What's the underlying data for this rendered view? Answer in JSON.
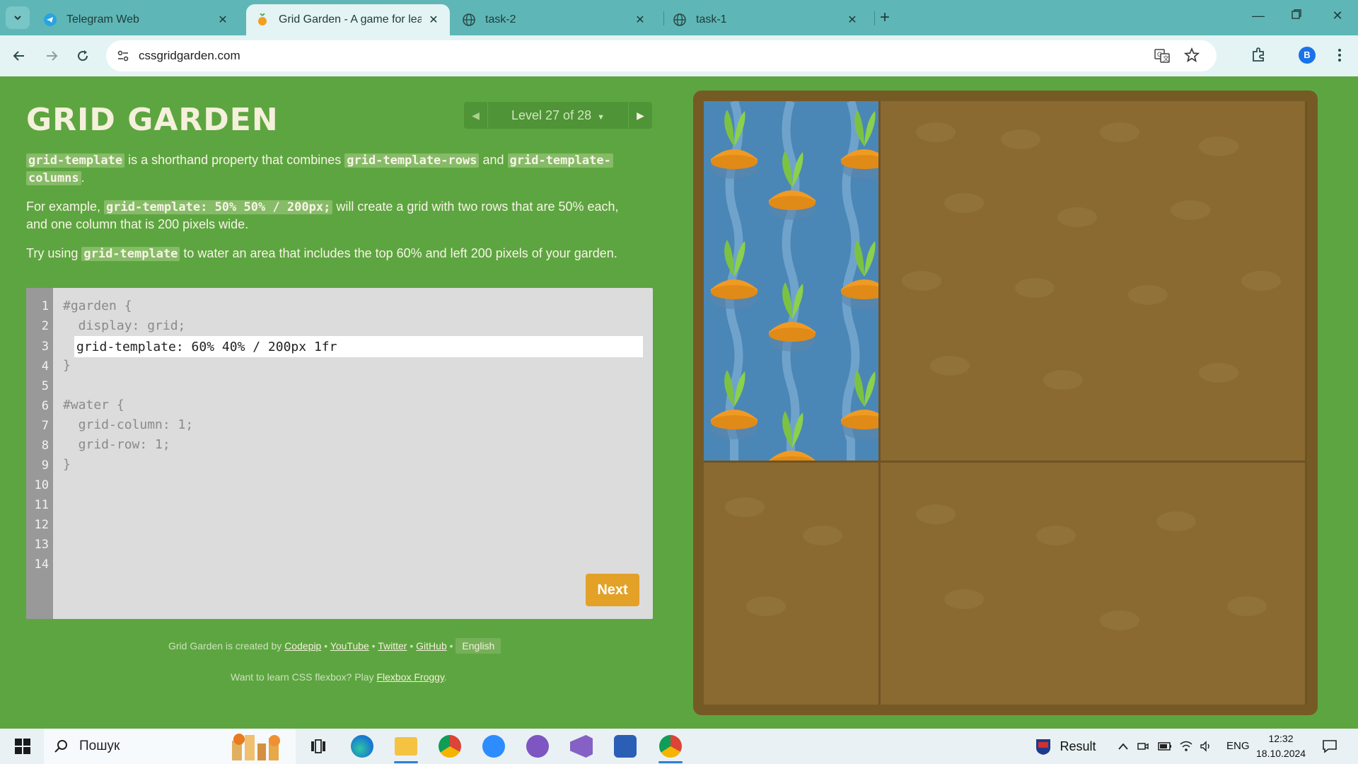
{
  "browser": {
    "tabs": [
      {
        "label": "Telegram Web",
        "icon": "telegram-icon"
      },
      {
        "label": "Grid Garden - A game for learni",
        "icon": "carrot-icon",
        "active": true
      },
      {
        "label": "task-2",
        "icon": "globe-icon"
      },
      {
        "label": "task-1",
        "icon": "globe-icon"
      }
    ],
    "url": "cssgridgarden.com",
    "profile_initial": "B"
  },
  "game": {
    "title": "GRID GARDEN",
    "level_label": "Level 27 of 28",
    "instructions": {
      "p1_code1": "grid-template",
      "p1_text1": " is a shorthand property that combines ",
      "p1_code2": "grid-template-rows",
      "p1_text2": " and ",
      "p1_code3a": "grid-template-",
      "p1_code3b": "columns",
      "p1_text3": ".",
      "p2_text1": "For example, ",
      "p2_code1": "grid-template: 50% 50% / 200px;",
      "p2_text2": " will create a grid with two rows that are 50% each,",
      "p2_text3": "and one column that is 200 pixels wide.",
      "p3_text1": "Try using ",
      "p3_code1": "grid-template",
      "p3_text2": " to water an area that includes the top 60% and left 200 pixels of your garden."
    },
    "editor": {
      "line_numbers": [
        "1",
        "2",
        "3",
        "4",
        "5",
        "6",
        "7",
        "8",
        "9",
        "10",
        "11",
        "12",
        "13",
        "14"
      ],
      "line1": "#garden {",
      "line2": "  display: grid;",
      "input_value": "grid-template: 60% 40% / 200px 1fr",
      "line4": "}",
      "line6": "#water {",
      "line7": "  grid-column: 1;",
      "line8": "  grid-row: 1;",
      "line9": "}",
      "next_label": "Next"
    },
    "footer": {
      "created_by": "Grid Garden is created by ",
      "codepip": "Codepip",
      "youtube": "YouTube",
      "twitter": "Twitter",
      "github": "GitHub",
      "bullet": " • ",
      "language": "English",
      "flexbox_prefix": "Want to learn CSS flexbox? Play ",
      "flexbox_link": "Flexbox Froggy",
      "flexbox_suffix": "."
    }
  },
  "taskbar": {
    "search_placeholder": "Пошук",
    "weather_label": "Result",
    "language": "ENG",
    "time": "12:32",
    "date": "18.10.2024"
  },
  "colors": {
    "page_bg": "#5da540",
    "tabbar_bg": "#5fb6b6",
    "water": "#4a87b6",
    "soil": "#8a6a30",
    "next_button": "#e3a128"
  }
}
